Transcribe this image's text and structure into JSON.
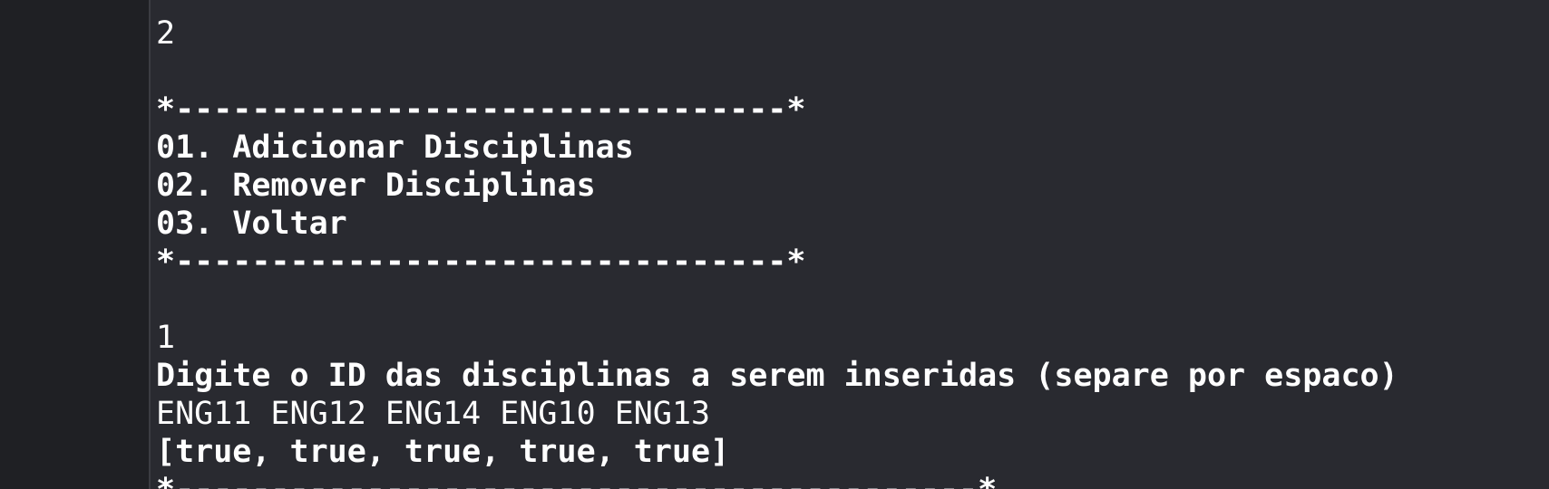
{
  "console": {
    "line1": "2",
    "border_top": "*--------------------------------*",
    "menu_item_1": "01. Adicionar Disciplinas",
    "menu_item_2": "02. Remover Disciplinas",
    "menu_item_3": "03. Voltar",
    "border_bottom": "*--------------------------------*",
    "choice_input": "1",
    "prompt": "Digite o ID das disciplinas a serem inseridas (separe por espaco)",
    "ids_input": "ENG11 ENG12 ENG14 ENG10 ENG13",
    "result": "[true, true, true, true, true]",
    "border_last": "*------------------------------------------*"
  }
}
